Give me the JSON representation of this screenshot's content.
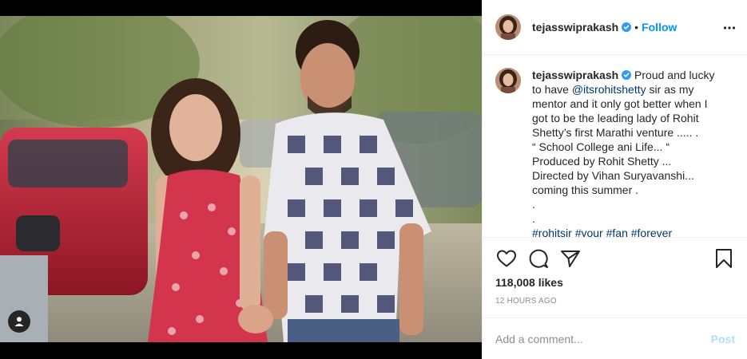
{
  "post": {
    "username": "tejasswiprakash",
    "verified": true,
    "follow_label": "Follow",
    "separator": "•"
  },
  "caption": {
    "username": "tejasswiprakash",
    "text_intro": " Proud and lucky to have ",
    "mention": "@itsrohitshetty",
    "text_rest": " sir as my mentor and it only got better when I got to be the leading lady of Rohit Shetty’s first Marathi venture ..... .",
    "lines": [
      "“ School College ani Life... “",
      "Produced by Rohit Shetty ...",
      "Directed by Vihan Suryavanshi...",
      "coming this summer .",
      ".",
      "."
    ],
    "hashtags": [
      "#rohitsir",
      "#your",
      "#fan",
      "#forever"
    ]
  },
  "stats": {
    "likes": "118,008 likes",
    "time": "12 HOURS AGO"
  },
  "comment": {
    "placeholder": "Add a comment...",
    "post_label": "Post"
  },
  "icons": {
    "like": "heart-icon",
    "comment": "comment-icon",
    "share": "share-icon",
    "save": "bookmark-icon",
    "more": "more-icon",
    "tags": "user-tag-icon",
    "verified": "verified-badge-icon"
  },
  "colors": {
    "link_blue": "#0095f6",
    "mention": "#00376b",
    "verified": "#3897f0",
    "post_disabled": "#b2dffc"
  }
}
